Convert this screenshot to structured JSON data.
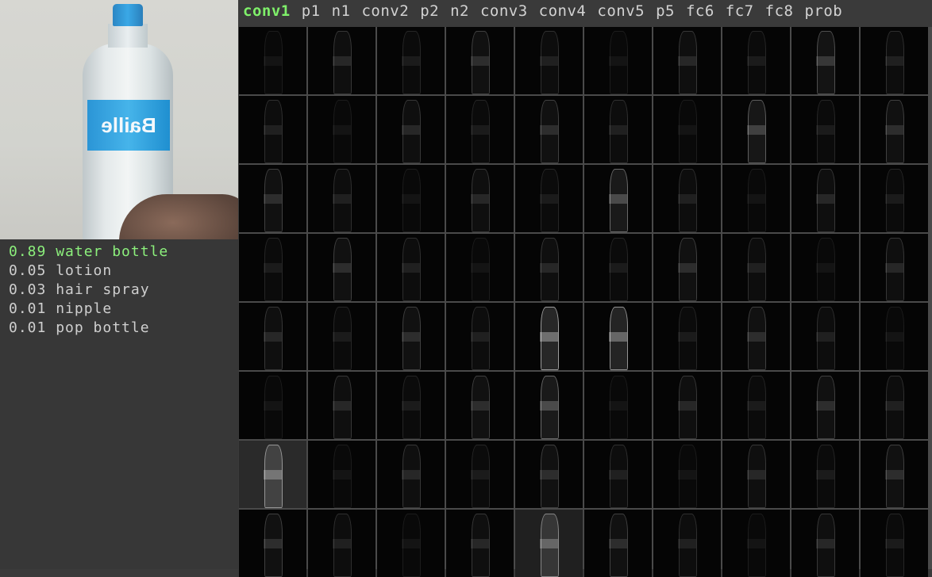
{
  "camera": {
    "label_text": "Baille",
    "icon": "camera-frame"
  },
  "predictions": [
    {
      "score": "0.89",
      "label": "water bottle"
    },
    {
      "score": "0.05",
      "label": "lotion"
    },
    {
      "score": "0.03",
      "label": "hair spray"
    },
    {
      "score": "0.01",
      "label": "nipple"
    },
    {
      "score": "0.01",
      "label": "pop bottle"
    }
  ],
  "layers": [
    "conv1",
    "p1",
    "n1",
    "conv2",
    "p2",
    "n2",
    "conv3",
    "conv4",
    "conv5",
    "p5",
    "fc6",
    "fc7",
    "fc8",
    "prob"
  ],
  "active_layer": "conv1",
  "colors": {
    "active_tab": "#7ff06a",
    "top_prediction": "#8cf07c",
    "text": "#d2d2d2",
    "grid_line": "#4a4a4a"
  },
  "grid": {
    "rows": 8,
    "cols": 10
  }
}
